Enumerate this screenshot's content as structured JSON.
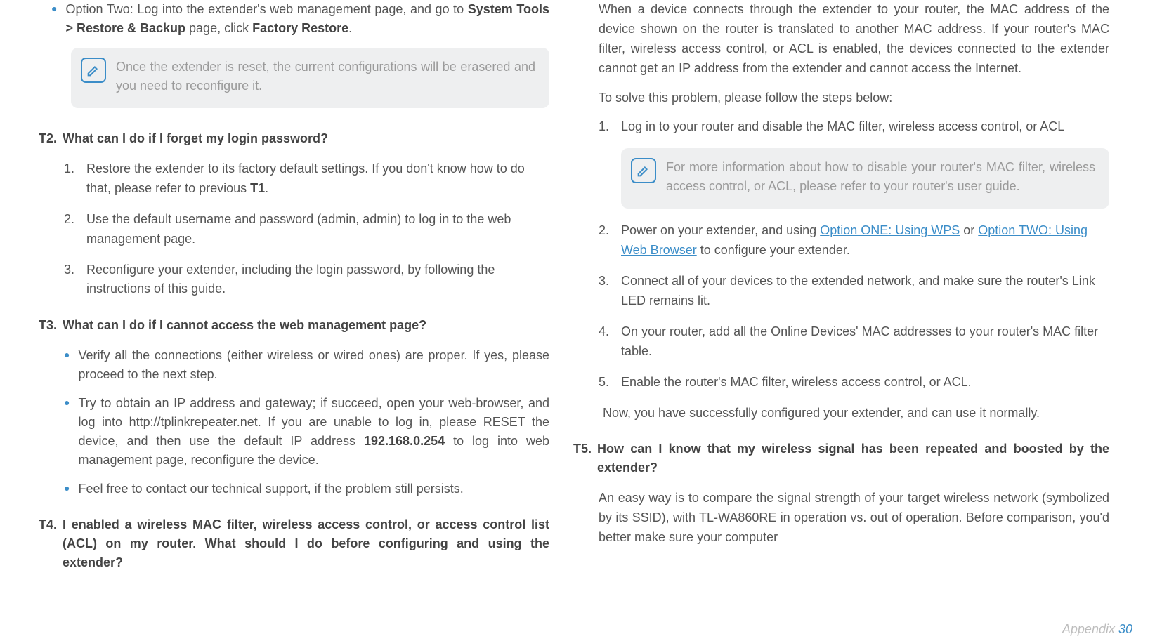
{
  "left": {
    "option_two": {
      "prefix": "Option Two: Log into the extender's web management page, and go to ",
      "bold1": "System Tools > Restore & Backup",
      "mid": " page, click ",
      "bold2": "Factory Restore",
      "suffix": "."
    },
    "note1": "Once the extender is reset, the current configurations will be erasered and you need to reconfigure it.",
    "t2": {
      "code": "T2.",
      "title": "What can I do if I forget my login password?"
    },
    "t2_items": {
      "i1": {
        "n": "1.",
        "prefix": "Restore the extender to its factory default settings. If you don't know how to do that, please refer to previous ",
        "bold": "T1",
        "suffix": "."
      },
      "i2": {
        "n": "2.",
        "text": "Use the default username and password (admin, admin) to log in to the web management page."
      },
      "i3": {
        "n": "3.",
        "text": "Reconfigure your extender, including the login password, by following the instructions of this guide."
      }
    },
    "t3": {
      "code": "T3.",
      "title": "What can I do if I cannot access the web management page?"
    },
    "t3_bullets": {
      "b1": "Verify all the connections (either wireless or wired ones) are proper. If yes, please proceed to the next step.",
      "b2": {
        "prefix": "Try to obtain an IP address and gateway; if succeed, open your web-browser, and log into http://tplinkrepeater.net. If you are unable to log in, please RESET the device, and then use the default IP address ",
        "bold": "192.168.0.254",
        "suffix": " to log into web management page, reconfigure the device."
      },
      "b3": "Feel free to contact our technical support, if the problem still persists."
    },
    "t4": {
      "code": "T4.",
      "title": "I enabled a wireless MAC filter, wireless access control, or access control list (ACL) on my router. What should I do before configuring and using the extender?"
    }
  },
  "right": {
    "intro": "When a device connects through the extender to your router, the MAC address of the device shown on the router is translated to another MAC address. If your router's MAC filter, wireless access control, or ACL is enabled, the devices connected to the extender cannot get an IP address from the extender and cannot access the Internet.",
    "solve": "To solve this problem, please follow the steps below:",
    "s1": {
      "n": "1.",
      "text": "Log in to your router and disable the MAC filter, wireless access control, or ACL"
    },
    "note2": "For more information about how to disable your router's MAC filter, wireless access control, or ACL, please refer to your router's user guide.",
    "s2": {
      "n": "2.",
      "prefix": "Power on your extender, and using ",
      "link1": "Option ONE: Using WPS",
      "mid": " or ",
      "link2": "Option TWO: Using Web Browser",
      "suffix": " to configure your extender."
    },
    "s3": {
      "n": "3.",
      "text": "Connect all of your devices to the extended network, and make sure the router's Link LED remains lit."
    },
    "s4": {
      "n": "4.",
      "text": "On your router, add all the Online Devices' MAC addresses to your router's MAC filter table."
    },
    "s5": {
      "n": "5.",
      "text": "Enable the router's MAC filter, wireless access control, or ACL."
    },
    "outro": "Now, you have successfully configured your extender, and can use it normally.",
    "t5": {
      "code": "T5.",
      "title": "How can I know that my wireless signal has been repeated and boosted by the extender?"
    },
    "t5_para": "An easy way is to compare the signal strength of your target wireless network (symbolized by its SSID), with TL-WA860RE in operation vs. out of operation. Before comparison, you'd better make sure your computer"
  },
  "footer": {
    "label": "Appendix ",
    "page": "30"
  }
}
